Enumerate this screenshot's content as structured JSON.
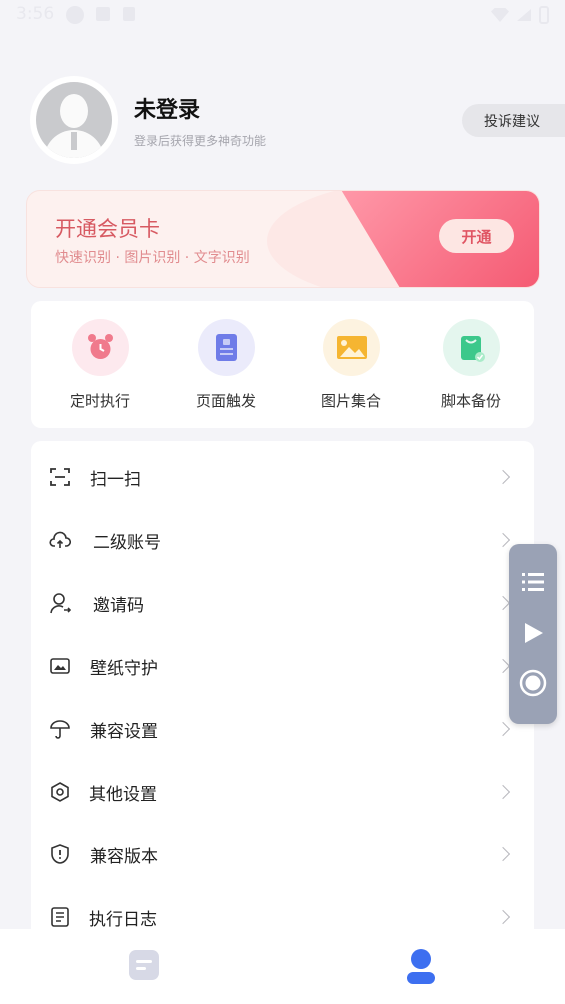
{
  "status_bar": {
    "time": "3:56"
  },
  "profile": {
    "name": "未登录",
    "subtitle": "登录后获得更多神奇功能",
    "feedback_label": "投诉建议"
  },
  "vip": {
    "title": "开通会员卡",
    "desc": "快速识别 · 图片识别 · 文字识别",
    "button_label": "开通"
  },
  "shortcuts": [
    {
      "label": "定时执行",
      "icon": "alarm-clock-icon",
      "bg": "#fde9ee",
      "color": "#f07a8c"
    },
    {
      "label": "页面触发",
      "icon": "document-icon",
      "bg": "#ebebfb",
      "color": "#6f7ce8"
    },
    {
      "label": "图片集合",
      "icon": "image-icon",
      "bg": "#fdf3e0",
      "color": "#f5b531"
    },
    {
      "label": "脚本备份",
      "icon": "shopping-bag-icon",
      "bg": "#e4f6ee",
      "color": "#3cc88b"
    }
  ],
  "menu": [
    {
      "label": "扫一扫",
      "icon": "scan-icon"
    },
    {
      "label": "二级账号",
      "icon": "cloud-upload-icon"
    },
    {
      "label": "邀请码",
      "icon": "user-invite-icon"
    },
    {
      "label": "壁纸守护",
      "icon": "wallpaper-icon"
    },
    {
      "label": "兼容设置",
      "icon": "umbrella-icon"
    },
    {
      "label": "其他设置",
      "icon": "hexagon-settings-icon"
    },
    {
      "label": "兼容版本",
      "icon": "shield-icon"
    },
    {
      "label": "执行日志",
      "icon": "log-icon"
    }
  ],
  "float_toolbar": [
    "list-icon",
    "play-icon",
    "record-icon"
  ],
  "bottom_nav": [
    {
      "name": "home-tab",
      "icon": "document-tab-icon",
      "active": false
    },
    {
      "name": "profile-tab",
      "icon": "person-tab-icon",
      "active": true
    }
  ]
}
